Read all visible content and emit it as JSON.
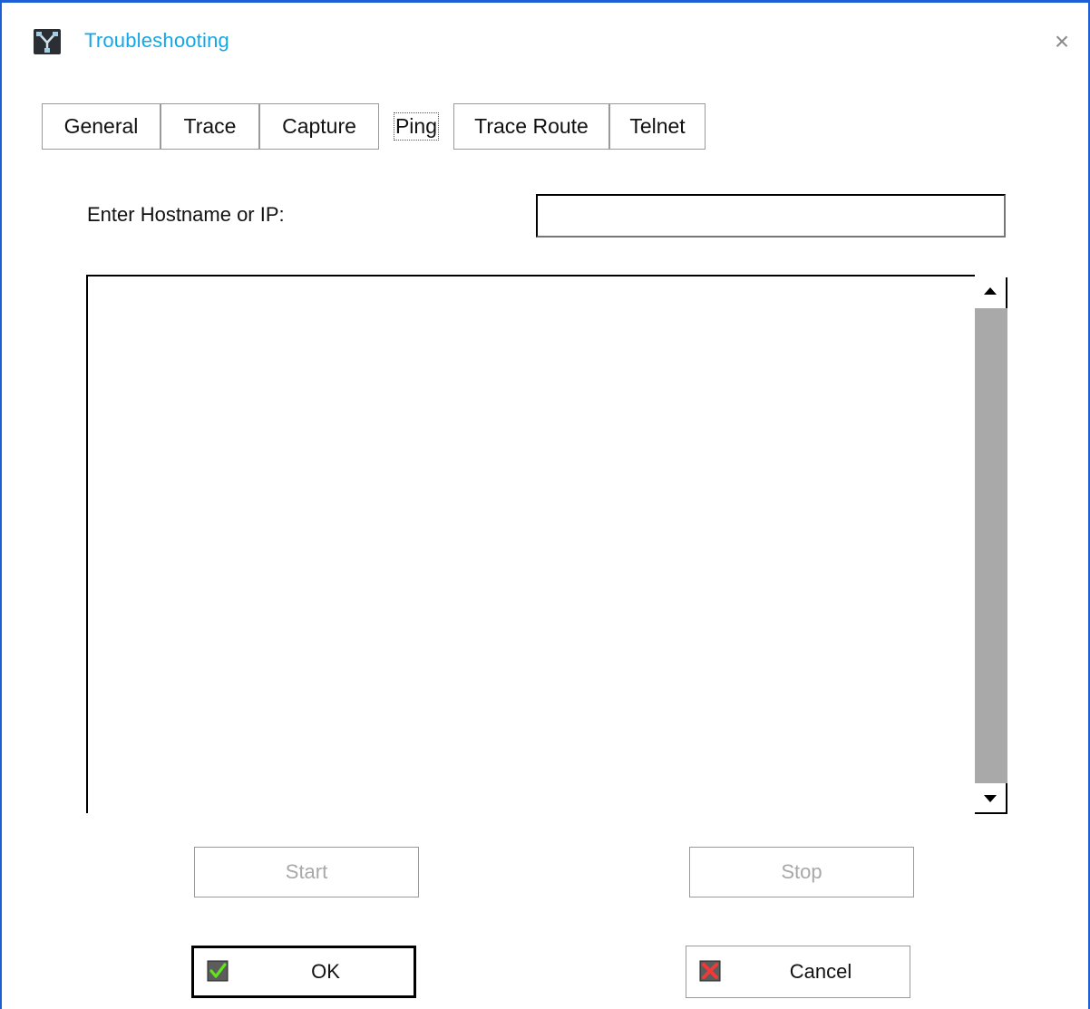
{
  "window": {
    "title": "Troubleshooting",
    "close_label": "×"
  },
  "tabs": [
    {
      "label": "General",
      "active": false
    },
    {
      "label": "Trace",
      "active": false
    },
    {
      "label": "Capture",
      "active": false
    },
    {
      "label": "Ping",
      "active": true
    },
    {
      "label": "Trace Route",
      "active": false
    },
    {
      "label": "Telnet",
      "active": false
    }
  ],
  "ping": {
    "host_label": "Enter Hostname or IP:",
    "host_value": "",
    "output_text": ""
  },
  "buttons": {
    "start": "Start",
    "stop": "Stop",
    "ok": "OK",
    "cancel": "Cancel"
  },
  "icons": {
    "app": "network-troubleshoot-icon",
    "ok": "green-checkmark-icon",
    "cancel": "red-x-icon"
  },
  "colors": {
    "window_border": "#1f5fd6",
    "title": "#12a8e8",
    "disabled_text": "#a8a8a8",
    "scroll_track": "#a9a9a9"
  }
}
